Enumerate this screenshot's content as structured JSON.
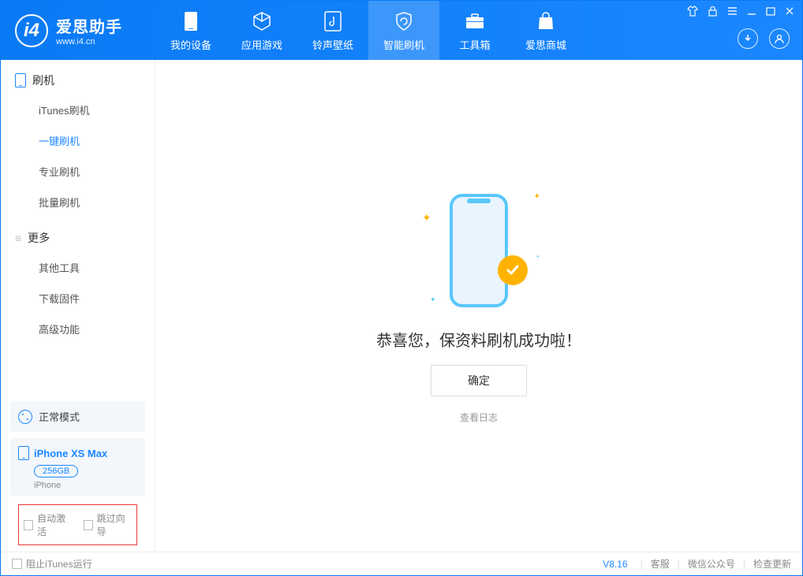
{
  "app": {
    "name_cn": "爱思助手",
    "name_en": "www.i4.cn"
  },
  "nav": {
    "items": [
      {
        "label": "我的设备"
      },
      {
        "label": "应用游戏"
      },
      {
        "label": "铃声壁纸"
      },
      {
        "label": "智能刷机"
      },
      {
        "label": "工具箱"
      },
      {
        "label": "爱思商城"
      }
    ]
  },
  "sidebar": {
    "group1_title": "刷机",
    "group1_items": [
      {
        "label": "iTunes刷机"
      },
      {
        "label": "一键刷机"
      },
      {
        "label": "专业刷机"
      },
      {
        "label": "批量刷机"
      }
    ],
    "group2_title": "更多",
    "group2_items": [
      {
        "label": "其他工具"
      },
      {
        "label": "下载固件"
      },
      {
        "label": "高级功能"
      }
    ],
    "mode_label": "正常模式",
    "device": {
      "name": "iPhone XS Max",
      "storage": "256GB",
      "type": "iPhone"
    },
    "chk_auto_activate": "自动激活",
    "chk_skip_guide": "跳过向导"
  },
  "main": {
    "success_msg": "恭喜您，保资料刷机成功啦！",
    "ok_label": "确定",
    "log_link": "查看日志"
  },
  "footer": {
    "block_itunes": "阻止iTunes运行",
    "version": "V8.16",
    "service": "客服",
    "wechat": "微信公众号",
    "update": "检查更新"
  }
}
